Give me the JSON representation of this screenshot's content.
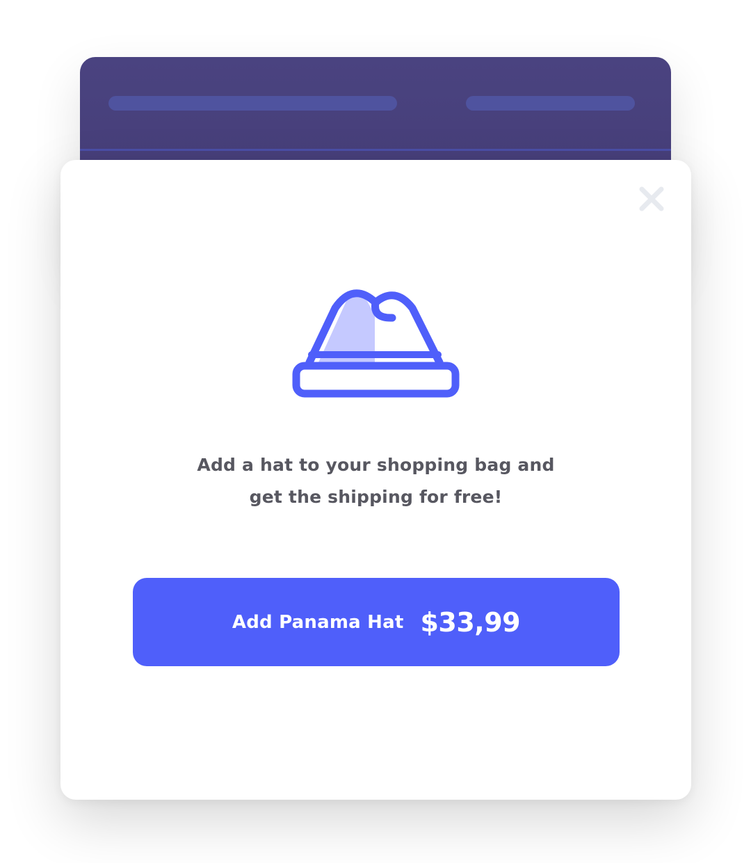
{
  "modal": {
    "message_line1": "Add a hat to your shopping bag and",
    "message_line2": "get the shipping for free!",
    "cta_label": "Add Panama Hat",
    "cta_price": "$33,99",
    "icons": [
      "hat-icon",
      "close-icon"
    ]
  },
  "colors": {
    "accent": "#4f5ffa",
    "accent_light": "#c5c9ff",
    "header_bg": "#463e7a",
    "text": "#575760",
    "close_icon": "#e7eaef"
  }
}
